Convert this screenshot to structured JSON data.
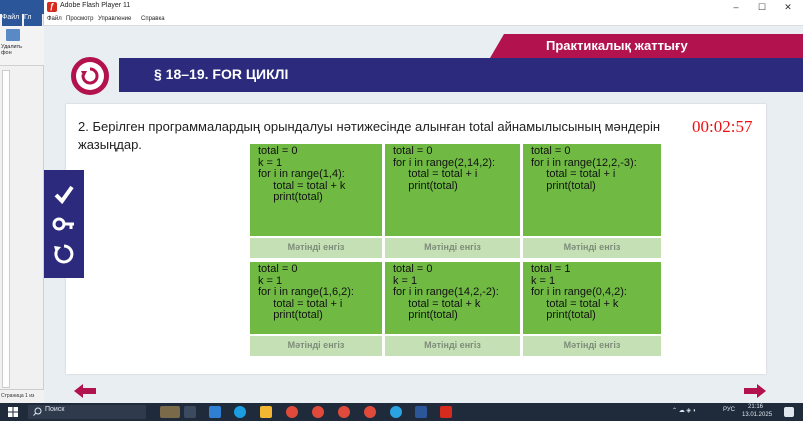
{
  "host": {
    "tabs": [
      "Файл",
      "Гл"
    ],
    "ribbon_item": "Удалить фон",
    "status": "Страница 1 из"
  },
  "window": {
    "title": "Adobe Flash Player 11",
    "menu": [
      "Файл",
      "Просмотр",
      "Управление",
      "Справка"
    ],
    "controls": [
      "–",
      "☐",
      "✕"
    ]
  },
  "slide": {
    "banner": "Практикалық жаттығу",
    "chapter": "§ 18–19. FOR ЦИКЛІ",
    "task": "2. Берілген программалардың орындалуы нәтижесінде алынған  total айнамылысының мәндерін жазыңдар.",
    "timer": "00:02:57",
    "input_placeholder": "Мәтінді енгіз",
    "cells": [
      {
        "code": "total = 0\nk = 1\nfor i in range(1,4):\n     total = total + k\n     print(total)",
        "input": "Мәтінді енгіз"
      },
      {
        "code": "total = 0\nfor i in range(2,14,2):\n     total = total + i\n     print(total)",
        "input": "Мәтінді енгіз"
      },
      {
        "code": "total = 0\nfor i in range(12,2,-3):\n     total = total + i\n     print(total)",
        "input": "Мәтінді енгіз"
      },
      {
        "code": "total = 0\nk = 1\nfor i in range(1,6,2):\n     total = total + i\n     print(total)",
        "input": "Мәтінді енгіз"
      },
      {
        "code": "total = 0\nk = 1\nfor i in range(14,2,-2):\n     total = total + k\n     print(total)",
        "input": "Мәтінді енгіз"
      },
      {
        "code": "total = 1\nk = 1\nfor i in range(0,4,2):\n     total = total + k\n     print(total)",
        "input": "Мәтінді енгіз"
      }
    ],
    "side_tools": [
      "check-icon",
      "key-icon",
      "reset-icon"
    ]
  },
  "taskbar": {
    "search": "Поиск",
    "lang": "РУС",
    "time": "21:16",
    "date": "13.01.2025"
  },
  "colors": {
    "accent": "#b2124d",
    "header": "#2b2a7d",
    "code_bg": "#70ba44",
    "input_bg": "#c5e0b4",
    "timer": "#ee1111"
  }
}
